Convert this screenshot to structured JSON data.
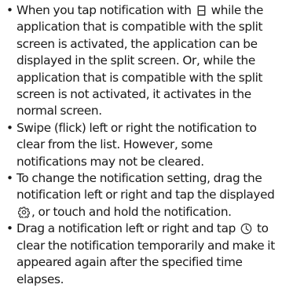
{
  "bullet_symbol": "•",
  "items": [
    {
      "before_icon": "When you tap notification with ",
      "icon": "split-screen-icon",
      "after_icon": " while the application that is compatible with the split screen is activated, the application can be displayed in the split screen. Or, while the application that is compatible with the split screen is not activated, it activates in the normal screen."
    },
    {
      "text": "Swipe (flick) left or right the notification to clear from the list. However, some notifications may not be cleared."
    },
    {
      "before_icon": "To change the notification setting, drag the notification left or right and tap the displayed ",
      "icon": "gear-icon",
      "after_icon": ", or touch and hold the notification."
    },
    {
      "before_icon": "Drag a notification left or right and tap ",
      "icon": "clock-icon",
      "after_icon": " to clear the notification temporarily and make it appeared again after the specified time elapses."
    }
  ]
}
